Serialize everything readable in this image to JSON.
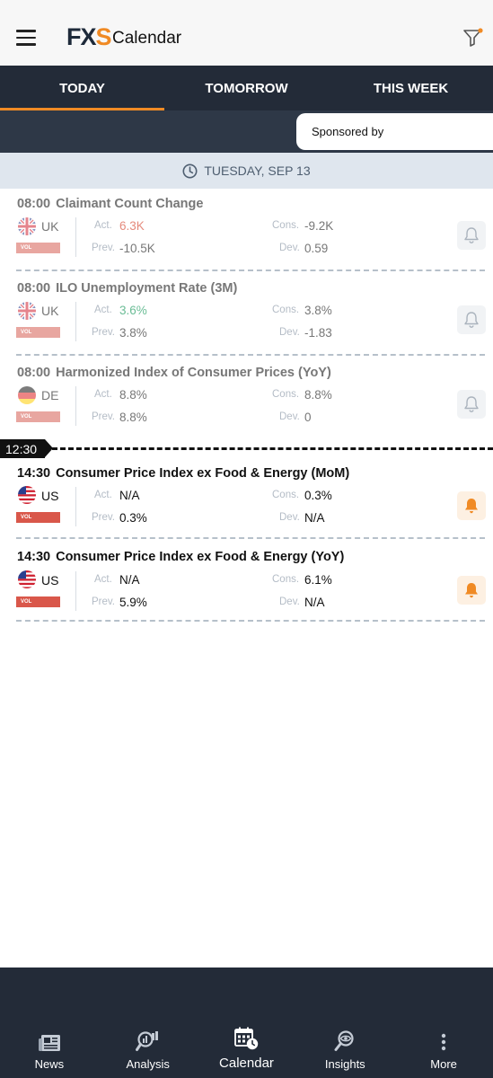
{
  "header": {
    "logo_text_1": "FX",
    "logo_text_2": "S",
    "title": "Calendar",
    "menu_icon": "hamburger-menu-icon",
    "filter_icon": "filter-icon",
    "accent_color": "#f08a24"
  },
  "tabs": [
    {
      "label": "TODAY",
      "active": true
    },
    {
      "label": "TOMORROW",
      "active": false
    },
    {
      "label": "THIS WEEK",
      "active": false
    }
  ],
  "sponsor": {
    "label": "Sponsored by"
  },
  "date": {
    "label": "TUESDAY, SEP 13",
    "icon": "clock-icon"
  },
  "now_marker": {
    "time": "12:30"
  },
  "labels": {
    "act": "Act.",
    "cons": "Cons.",
    "prev": "Prev.",
    "dev": "Dev.",
    "vol": "VOL"
  },
  "events": [
    {
      "time": "08:00",
      "title": "Claimant Count Change",
      "country": "UK",
      "act": "6.3K",
      "cons": "-9.2K",
      "prev": "-10.5K",
      "dev": "0.59",
      "alert_on": false
    },
    {
      "time": "08:00",
      "title": "ILO Unemployment Rate (3M)",
      "country": "UK",
      "act": "3.6%",
      "cons": "3.8%",
      "prev": "3.8%",
      "dev": "-1.83",
      "alert_on": false
    },
    {
      "time": "08:00",
      "title": "Harmonized Index of Consumer Prices (YoY)",
      "country": "DE",
      "act": "8.8%",
      "cons": "8.8%",
      "prev": "8.8%",
      "dev": "0",
      "alert_on": false
    },
    {
      "time": "14:30",
      "title": "Consumer Price Index ex Food & Energy (MoM)",
      "country": "US",
      "act": "N/A",
      "cons": "0.3%",
      "prev": "0.3%",
      "dev": "N/A",
      "alert_on": true
    },
    {
      "time": "14:30",
      "title": "Consumer Price Index ex Food & Energy (YoY)",
      "country": "US",
      "act": "N/A",
      "cons": "6.1%",
      "prev": "5.9%",
      "dev": "N/A",
      "alert_on": true
    }
  ],
  "bottom_nav": [
    {
      "label": "News",
      "icon": "newspaper-icon"
    },
    {
      "label": "Analysis",
      "icon": "analysis-magnifier-icon"
    },
    {
      "label": "Calendar",
      "icon": "calendar-clock-icon",
      "active": true
    },
    {
      "label": "Insights",
      "icon": "insights-eye-icon"
    },
    {
      "label": "More",
      "icon": "more-vertical-icon"
    }
  ]
}
